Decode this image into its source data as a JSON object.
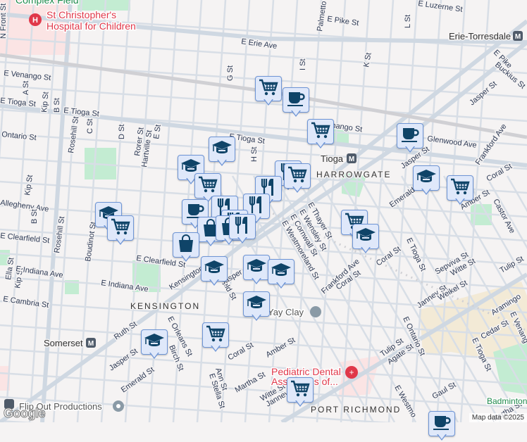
{
  "map": {
    "pois": {
      "hospital": [
        "St Christopher's",
        "Hospital for Children"
      ],
      "dental": [
        "Pediatric Dental",
        "Associates of..."
      ],
      "yay_clay": "Yay Clay",
      "flip_out": "Flip Out Productions",
      "badminton": "Badminton",
      "complex": "Complex Field"
    },
    "stations": {
      "erie": "Erie-Torresdale",
      "tioga": "Tioga",
      "somerset": "Somerset",
      "metro_glyph": "M"
    },
    "neighborhoods": [
      "HARROWGATE",
      "KENSINGTON",
      "PORT RICHMOND"
    ],
    "streets": [
      "N Front St",
      "E Erie Ave",
      "E Venango St",
      "A St",
      "E Tioga St",
      "E Tioga St",
      "E Tioga St",
      "Kip St",
      "B St",
      "Ontario St",
      "Rosehill St",
      "C St",
      "D St",
      "Rorer St",
      "Hartville St",
      "E St",
      "G St",
      "H St",
      "I St",
      "K St",
      "L St",
      "Palmetto St",
      "E Pike St",
      "E Luzerne St",
      "E Pike",
      "Buckius St",
      "Jasper St",
      "E Venango St",
      "Glenwood Ave",
      "Frankford Ave",
      "Jasper St",
      "Coral St",
      "Emerald St",
      "Amber St",
      "Castor Ave",
      "Allegheny Ave",
      "Kip St",
      "B St",
      "Rosehill St",
      "Boudinot St",
      "E Clearfield St",
      "E Clearfield St",
      "Ella St",
      "Kip St",
      "E Indiana Ave",
      "E Indiana Ave",
      "E Cambria St",
      "Kensington Ave",
      "Clearfield St",
      "Ruth St",
      "E Orleans St",
      "Birch St",
      "Jasper St",
      "Emerald St",
      "Coral St",
      "Amber St",
      "Ann St",
      "E Stella St",
      "Martha St",
      "E Thayer St",
      "E Wensley St",
      "E Cornwall St",
      "E Westmoreland St",
      "Frankford Ave",
      "Coral St",
      "Coral St",
      "E Tioga St",
      "Sepviva St",
      "Witte St",
      "Janney St",
      "Weikel St",
      "Tulip St",
      "Aramingo",
      "E Ontario St",
      "Cedar St",
      "E Tioga St",
      "E Venang",
      "Tulip St",
      "Agate St",
      "Gaul St",
      "E Westmo",
      "Witte St",
      "Janney",
      "Jasper St",
      "Martha St"
    ],
    "marker_types": [
      "shopping-cart",
      "coffee-cup",
      "school",
      "restaurant",
      "shopping-bag"
    ],
    "attribution": "Map data ©2025",
    "logo": "Google",
    "colors": {
      "marker_fill": "#dfe8fa",
      "marker_border": "#6e95d6",
      "icon": "#0f4468",
      "hospital": "#e0384a",
      "park": "#c3ecd2"
    }
  }
}
